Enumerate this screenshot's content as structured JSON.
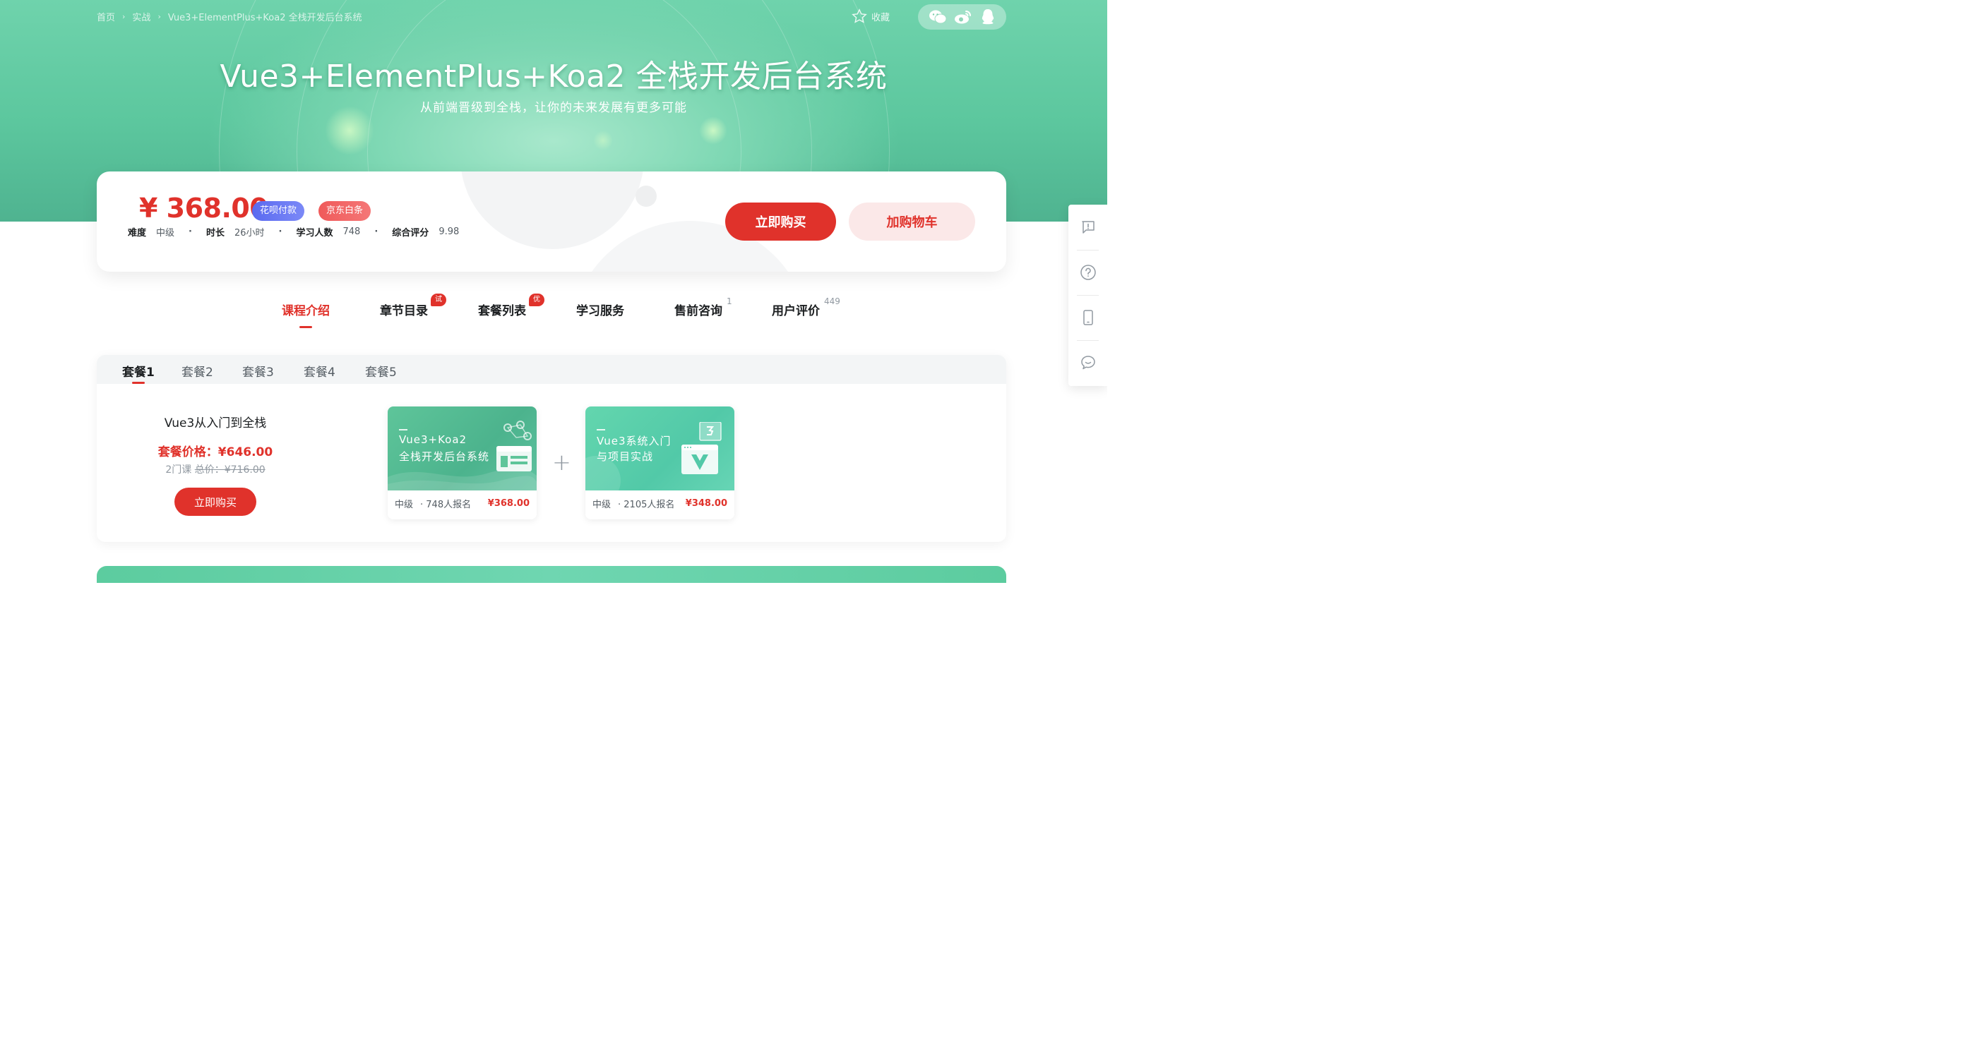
{
  "breadcrumb": {
    "home": "首页",
    "category": "实战",
    "current": "Vue3+ElementPlus+Koa2 全栈开发后台系统",
    "sep": "›"
  },
  "favorite_label": "收藏",
  "share_icons": [
    "wechat-icon",
    "weibo-icon",
    "qq-icon"
  ],
  "hero": {
    "title": "Vue3+ElementPlus+Koa2 全栈开发后台系统",
    "subtitle": "从前端晋级到全栈，让你的未来发展有更多可能"
  },
  "price_card": {
    "price": "¥ 368.00",
    "badges": [
      "花呗付款",
      "京东白条"
    ],
    "meta": [
      {
        "label": "难度",
        "value": "中级"
      },
      {
        "label": "时长",
        "value": "26小时"
      },
      {
        "label": "学习人数",
        "value": "748"
      },
      {
        "label": "综合评分",
        "value": "9.98"
      }
    ],
    "dot": "·",
    "buy_label": "立即购买",
    "cart_label": "加购物车"
  },
  "nav_tabs": [
    {
      "label": "课程介绍",
      "active": true
    },
    {
      "label": "章节目录",
      "tag": "试看"
    },
    {
      "label": "套餐列表",
      "tag": "优惠"
    },
    {
      "label": "学习服务"
    },
    {
      "label": "售前咨询",
      "count": "1"
    },
    {
      "label": "用户评价",
      "count": "449"
    }
  ],
  "packages": {
    "tabs": [
      "套餐1",
      "套餐2",
      "套餐3",
      "套餐4",
      "套餐5"
    ],
    "active_index": 0,
    "name": "Vue3从入门到全栈",
    "price_text": "套餐价格：¥646.00",
    "count_text": "2门课",
    "total_text": "总价：¥716.00",
    "buy_label": "立即购买",
    "plus": "+",
    "courses": [
      {
        "title_lines": [
          "Vue3+Koa2",
          "全栈开发后台系统"
        ],
        "level": "中级",
        "enroll": "· 748人报名",
        "price": "¥368.00"
      },
      {
        "title_lines": [
          "Vue3系统入门",
          "与项目实战"
        ],
        "level": "中级",
        "enroll": "· 2105人报名",
        "price": "¥348.00"
      }
    ]
  },
  "side_tools": [
    "feedback-icon",
    "help-icon",
    "mobile-icon",
    "chat-icon"
  ],
  "colors": {
    "accent": "#e0322b",
    "hero_green": "#5cc79e",
    "badge_blue": "#5b6af0"
  }
}
